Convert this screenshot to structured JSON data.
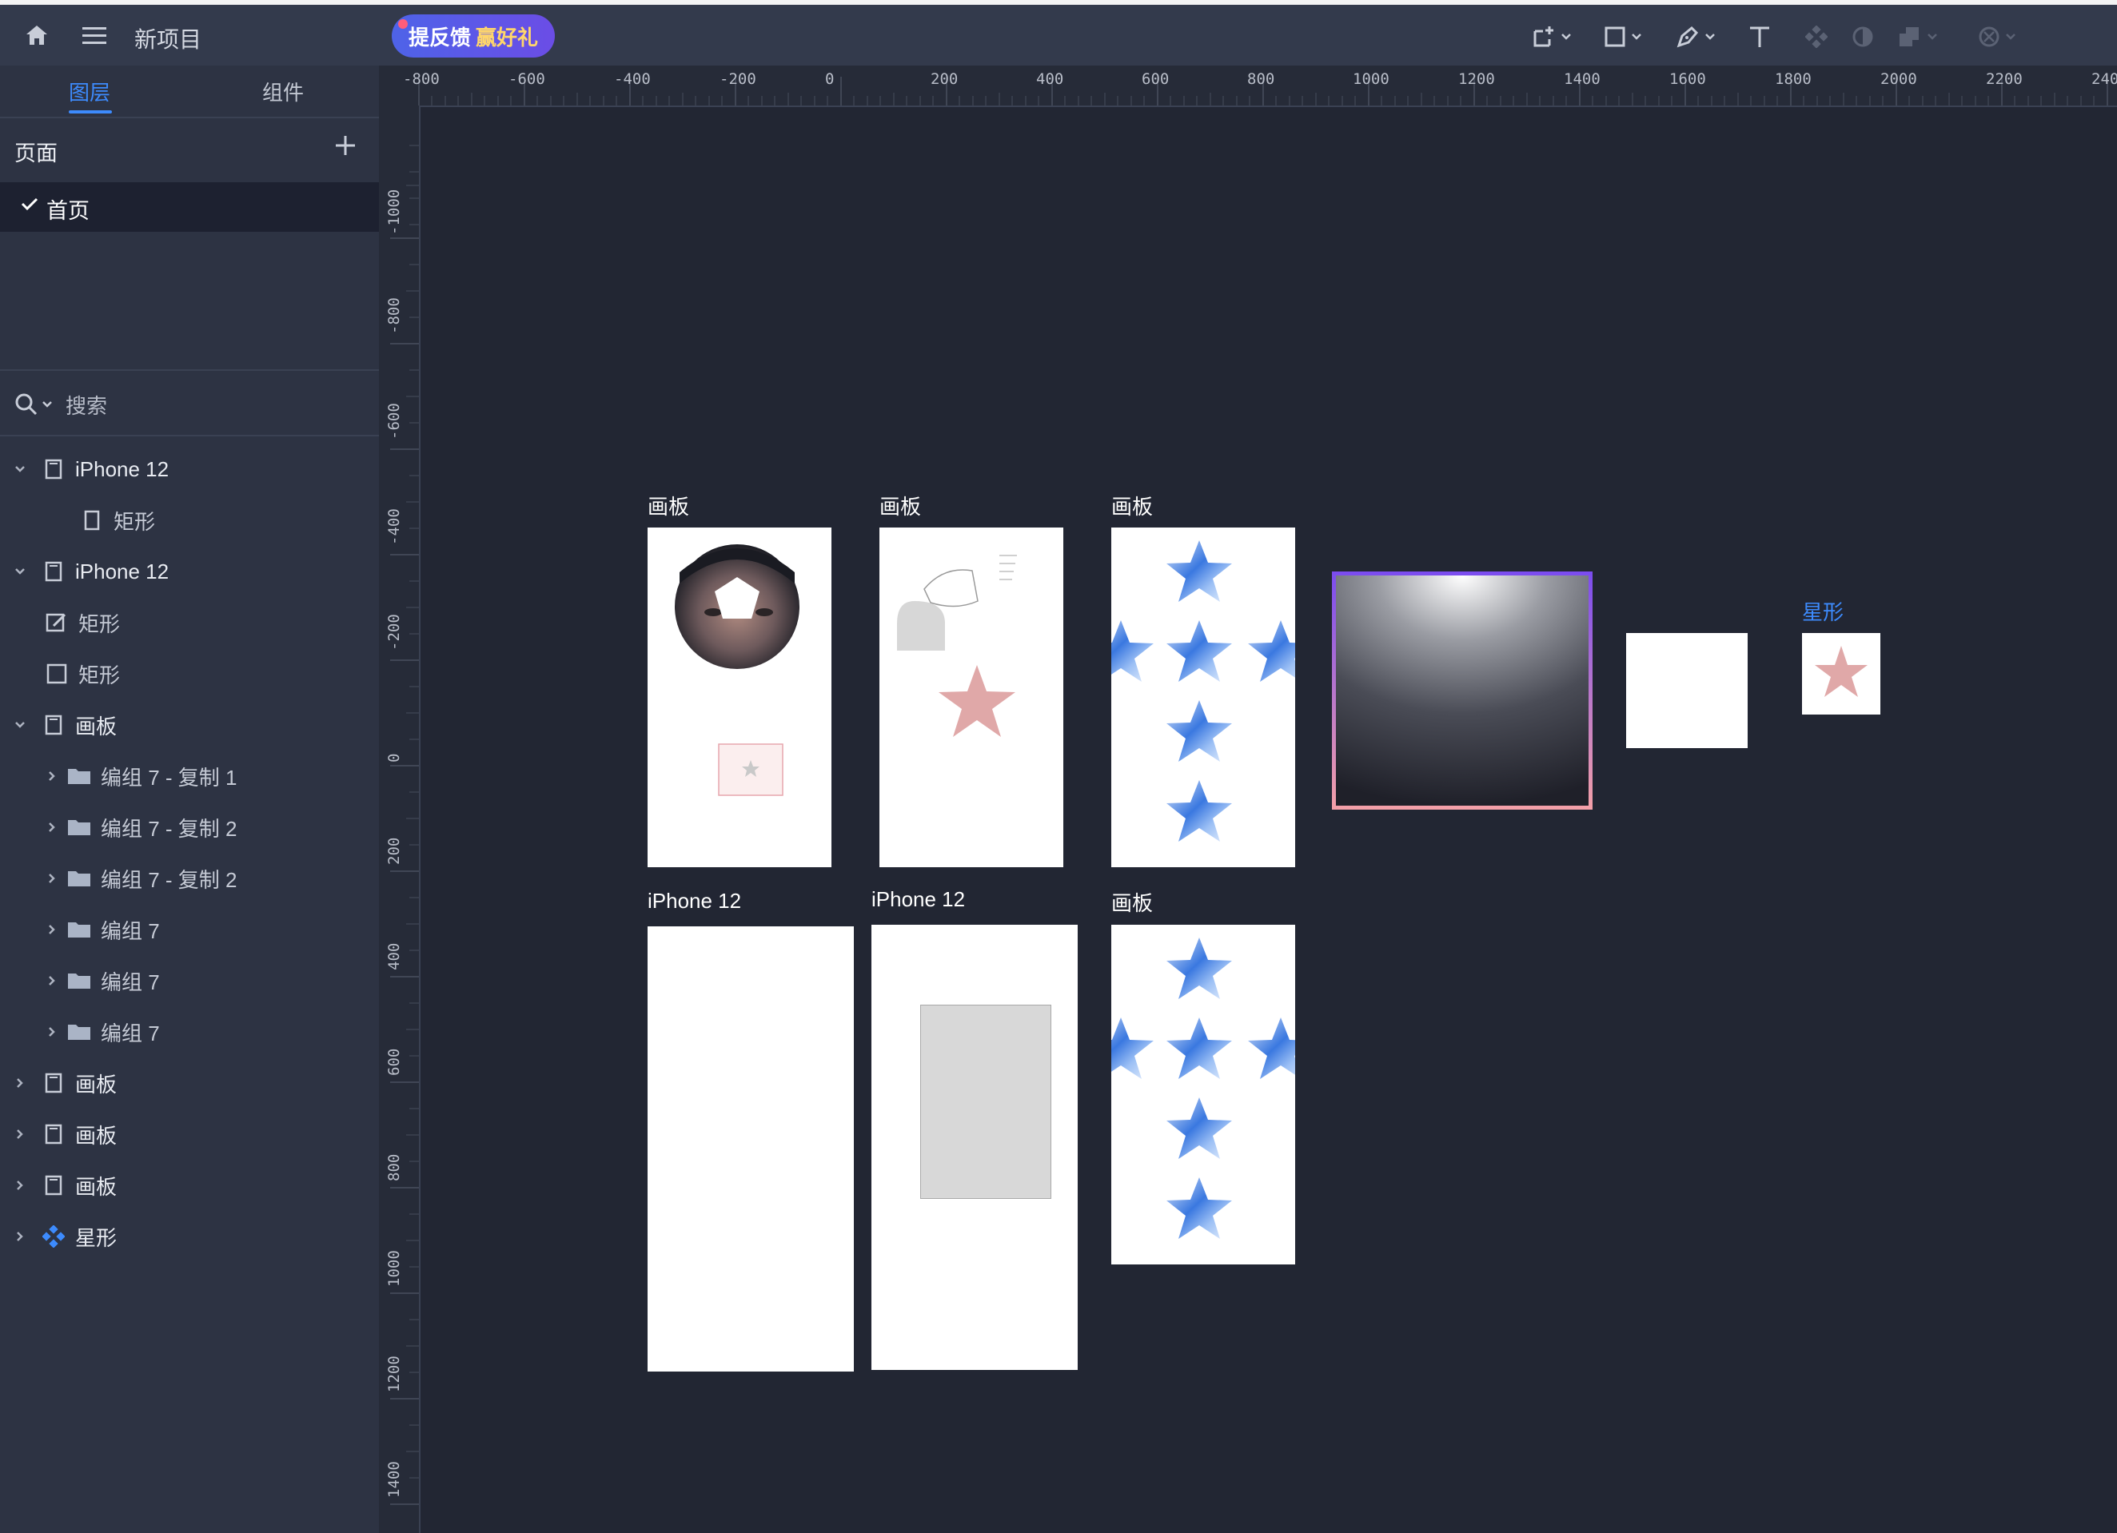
{
  "topbar": {
    "project_name": "新项目",
    "feedback_label": "提反馈",
    "feedback_gift": "赢好礼",
    "icons": [
      "home-icon",
      "menu-icon",
      "artboard-tool-icon",
      "shape-tool-icon",
      "pen-tool-icon",
      "text-tool-icon",
      "component-icon",
      "mask-icon",
      "boolean-icon",
      "more-icon"
    ]
  },
  "sidebar": {
    "tabs": [
      {
        "label": "图层"
      },
      {
        "label": "组件"
      }
    ],
    "pages_title": "页面",
    "current_page": "首页",
    "search_placeholder": "搜索",
    "layers": [
      {
        "label": "iPhone 12"
      },
      {
        "label": "矩形"
      },
      {
        "label": "iPhone 12"
      },
      {
        "label": "矩形"
      },
      {
        "label": "矩形"
      },
      {
        "label": "画板"
      },
      {
        "label": "编组 7 - 复制 1"
      },
      {
        "label": "编组 7 - 复制 2"
      },
      {
        "label": "编组 7 - 复制 2"
      },
      {
        "label": "编组 7"
      },
      {
        "label": "编组 7"
      },
      {
        "label": "编组 7"
      },
      {
        "label": "画板"
      },
      {
        "label": "画板"
      },
      {
        "label": "画板"
      },
      {
        "label": "星形"
      }
    ]
  },
  "ruler": {
    "top": [
      "-800",
      "-600",
      "-400",
      "-200",
      "0",
      "200",
      "400",
      "600",
      "800",
      "1000",
      "1200",
      "1400",
      "1600",
      "1800",
      "2000",
      "2200",
      "240"
    ],
    "left": [
      "-1000",
      "-800",
      "-600",
      "-400",
      "-200",
      "0",
      "200",
      "400",
      "600",
      "800",
      "1000",
      "1200",
      "1400"
    ]
  },
  "canvas": {
    "frames": [
      {
        "label": "画板"
      },
      {
        "label": "画板"
      },
      {
        "label": "画板"
      },
      {
        "label": "iPhone 12"
      },
      {
        "label": "iPhone 12"
      },
      {
        "label": "画板"
      },
      {
        "label": "星形"
      }
    ],
    "colors": {
      "accent": "#3d8bfd",
      "star_pink": "#e0a8a8",
      "star_blue": "#3a78e0",
      "gradient_border_top": "#7b4cf0",
      "gradient_border_bottom": "#f4a0a8"
    }
  }
}
